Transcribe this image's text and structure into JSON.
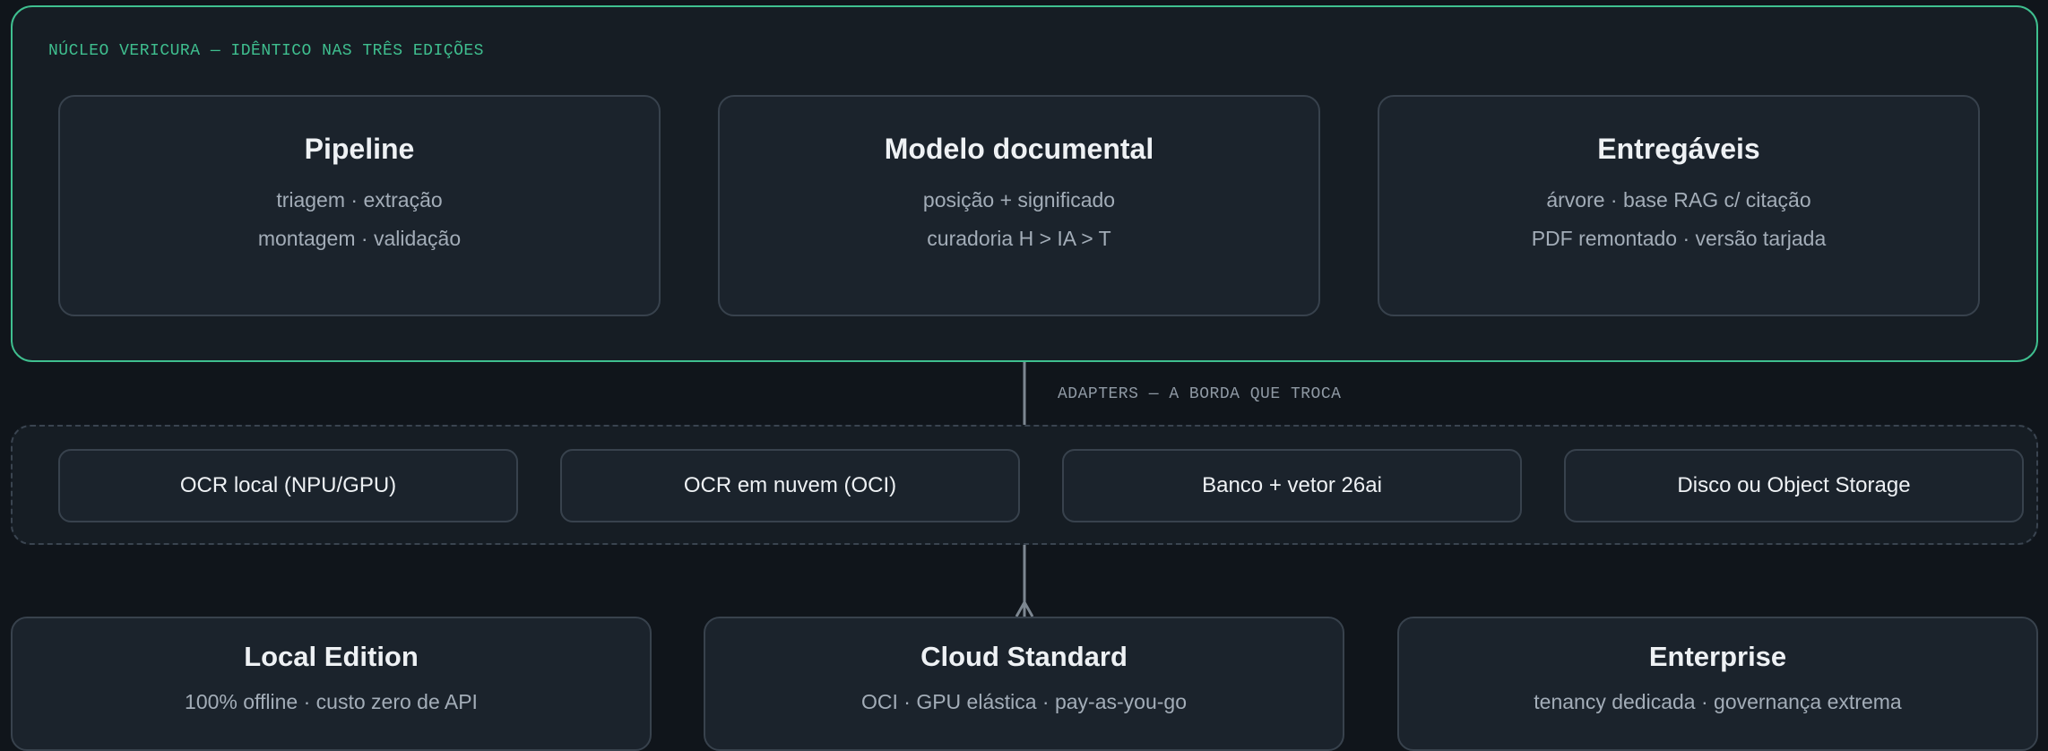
{
  "core": {
    "label": "NÚCLEO VERICURA — IDÊNTICO NAS TRÊS EDIÇÕES",
    "boxes": [
      {
        "title": "Pipeline",
        "line1": "triagem · extração",
        "line2": "montagem · validação"
      },
      {
        "title": "Modelo documental",
        "line1": "posição + significado",
        "line2": "curadoria H > IA > T"
      },
      {
        "title": "Entregáveis",
        "line1": "árvore · base RAG c/ citação",
        "line2": "PDF remontado · versão tarjada"
      }
    ]
  },
  "adapters": {
    "label": "ADAPTERS — A BORDA QUE TROCA",
    "items": [
      "OCR local (NPU/GPU)",
      "OCR em nuvem (OCI)",
      "Banco + vetor 26ai",
      "Disco ou Object Storage"
    ]
  },
  "editions": [
    {
      "title": "Local Edition",
      "subtitle": "100% offline · custo zero de API"
    },
    {
      "title": "Cloud Standard",
      "subtitle": "OCI · GPU elástica · pay-as-you-go"
    },
    {
      "title": "Enterprise",
      "subtitle": "tenancy dedicada · governança extrema"
    }
  ],
  "colors": {
    "background": "#10151b",
    "panel": "#161d24",
    "box": "#1b232c",
    "core_accent": "#3fbf8f",
    "connector": "#7d8791"
  }
}
